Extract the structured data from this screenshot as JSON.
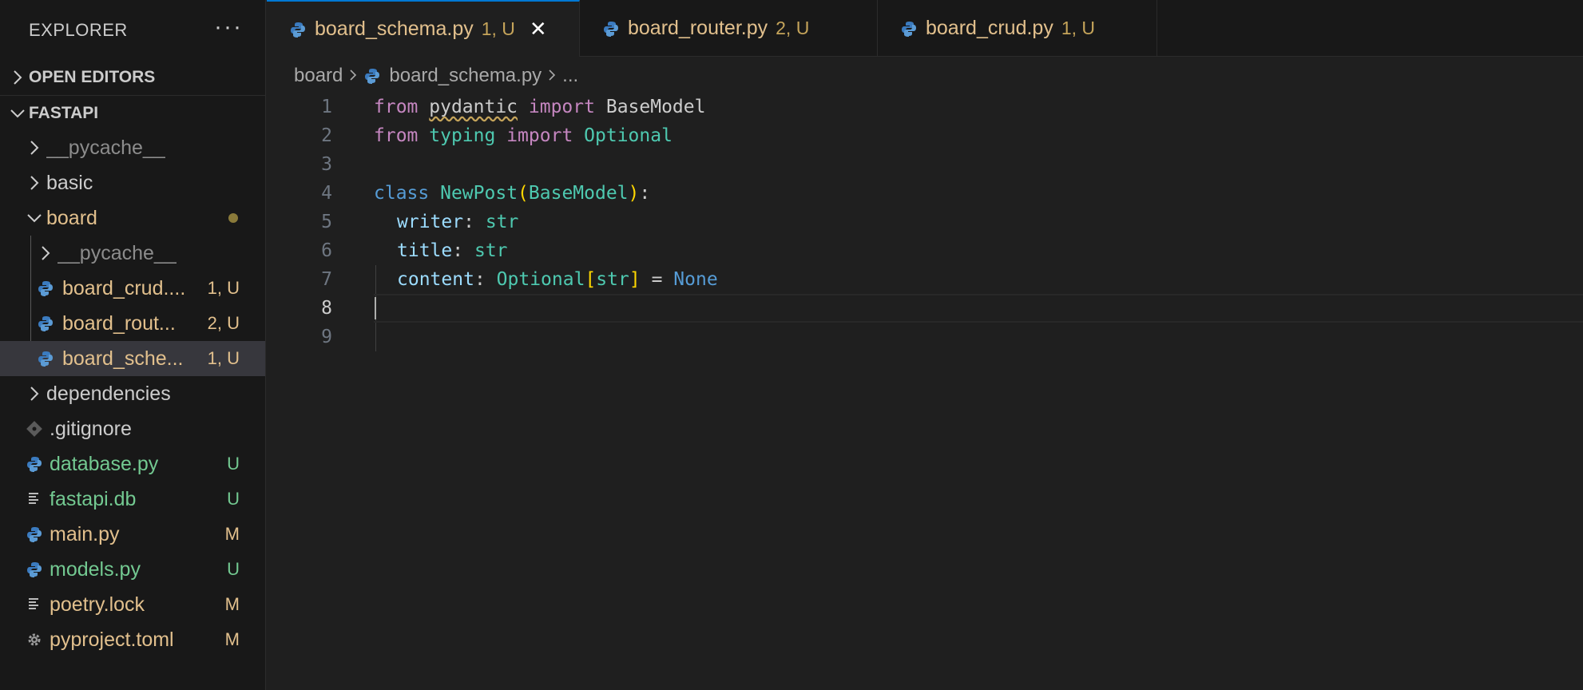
{
  "sidebar": {
    "title": "EXPLORER",
    "more": "···",
    "open_editors": "OPEN EDITORS",
    "project": "FASTAPI",
    "items": [
      {
        "label": "__pycache__",
        "badge": ""
      },
      {
        "label": "basic",
        "badge": ""
      },
      {
        "label": "board",
        "badge": ""
      },
      {
        "label": "__pycache__",
        "badge": ""
      },
      {
        "label": "board_crud....",
        "badge": "1, U"
      },
      {
        "label": "board_rout...",
        "badge": "2, U"
      },
      {
        "label": "board_sche...",
        "badge": "1, U"
      },
      {
        "label": "dependencies",
        "badge": ""
      },
      {
        "label": ".gitignore",
        "badge": ""
      },
      {
        "label": "database.py",
        "badge": "U"
      },
      {
        "label": "fastapi.db",
        "badge": "U"
      },
      {
        "label": "main.py",
        "badge": "M"
      },
      {
        "label": "models.py",
        "badge": "U"
      },
      {
        "label": "poetry.lock",
        "badge": "M"
      },
      {
        "label": "pyproject.toml",
        "badge": "M"
      }
    ]
  },
  "tabs": [
    {
      "label": "board_schema.py",
      "badge": "1, U",
      "close": "✕"
    },
    {
      "label": "board_router.py",
      "badge": "2, U"
    },
    {
      "label": "board_crud.py",
      "badge": "1, U"
    }
  ],
  "breadcrumb": {
    "folder": "board",
    "file": "board_schema.py",
    "more": "..."
  },
  "editor": {
    "line_numbers": [
      "1",
      "2",
      "3",
      "4",
      "5",
      "6",
      "7",
      "8",
      "9"
    ],
    "tokens": {
      "from": "from",
      "pydantic": "pydantic",
      "import": "import",
      "BaseModel": "BaseModel",
      "typing": "typing",
      "Optional": "Optional",
      "class": "class",
      "NewPost": "NewPost",
      "lparen": "(",
      "rparen": ")",
      "colon": ":",
      "writer": "writer",
      "title": "title",
      "content": "content",
      "str": "str",
      "lbracket": "[",
      "rbracket": "]",
      "equals": "=",
      "None": "None"
    }
  },
  "colors": {
    "accent": "#0078d4",
    "modified_untracked_yellow": "#e2c08d",
    "untracked_green": "#73c991"
  }
}
